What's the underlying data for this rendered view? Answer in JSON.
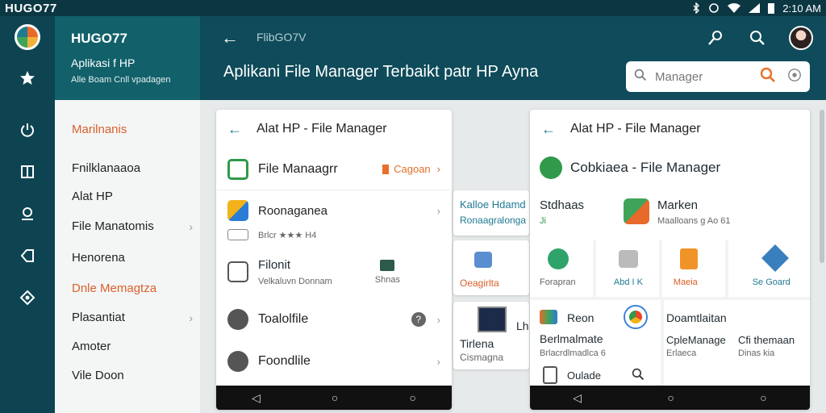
{
  "status_bar": {
    "brand": "HUGO77",
    "time": "2:10 AM"
  },
  "header_panel": {
    "name": "HUGO77",
    "subtitle": "Aplikasi f HP",
    "caption": "Alle Boam Cnll vpadagen"
  },
  "topbar": {
    "breadcrumb": "FlibGO7V",
    "title": "Aplikani File Manager Terbaikt patr HP Ayna",
    "search_placeholder": "Manager"
  },
  "sidebar": {
    "items": [
      {
        "label": "Marilnanis",
        "accent": true
      },
      {
        "label": "Fnilklanaaoa"
      },
      {
        "label": "Alat HP"
      },
      {
        "label": "File Manatomis",
        "chevron": "›"
      },
      {
        "label": "Henorena"
      },
      {
        "label": "Dnle Memagtza",
        "accent": true
      },
      {
        "label": "Plasantiat",
        "chevron": "›"
      },
      {
        "label": "Amoter"
      },
      {
        "label": "Vile Doon"
      }
    ]
  },
  "card1": {
    "title": "Alat HP - File Manager",
    "row1": {
      "title": "File Manaagrr",
      "badge": "Cagoan"
    },
    "row2": {
      "title": "Roonaganea",
      "meta": "Brlcr ★★★ H4"
    },
    "row3": {
      "title": "Filonit",
      "sub": "Velkaluvn Donnam",
      "side": "Shnas"
    },
    "row4": {
      "title": "Toalolfile"
    },
    "row5": {
      "title": "Foondlile"
    }
  },
  "mid_tiles": {
    "tile1_title": "Kalloe Hdamd",
    "tile1_sub": "Ronaagra",
    "tile1_side": "Ionga",
    "tile2_label": "Oeagirlta",
    "tile3_title": "Tirlena",
    "tile3_side": "Lh",
    "tile3_sub": "Cismagna"
  },
  "card2": {
    "title": "Alat HP - File Manager",
    "main_title": "Cobkiaea - File Manager",
    "col1_title": "Stdhaas",
    "col1_sub": "Ji",
    "col2_title": "Marken",
    "col2_sub": "Maalloans g Ao 61",
    "tiles": [
      "Forapran",
      "Abd I K",
      "Maeia",
      "Se Goard"
    ],
    "row_a": {
      "title": "Reon",
      "sub1": "Berlmalmate",
      "sub2": "Brlacrdlmadlca 6",
      "sub3": "Oulade"
    },
    "row_b": {
      "title": "Doamtlaitan",
      "sub1": "CpleManage",
      "sub1_side": "Cfi themaan",
      "sub2": "Erlaeca",
      "sub2_side": "Dinas kia"
    }
  },
  "colors": {
    "accent": "#d9602a",
    "teal": "#0f4b5a",
    "brand_teal": "#1f7a92"
  },
  "icons": [
    "back-arrow-icon",
    "wrench-search-icon",
    "search-icon",
    "star-icon",
    "power-icon",
    "book-icon",
    "location-icon",
    "tag-icon",
    "nav-settings-icon",
    "chevron-right-icon",
    "nav-back-icon",
    "nav-home-icon"
  ]
}
